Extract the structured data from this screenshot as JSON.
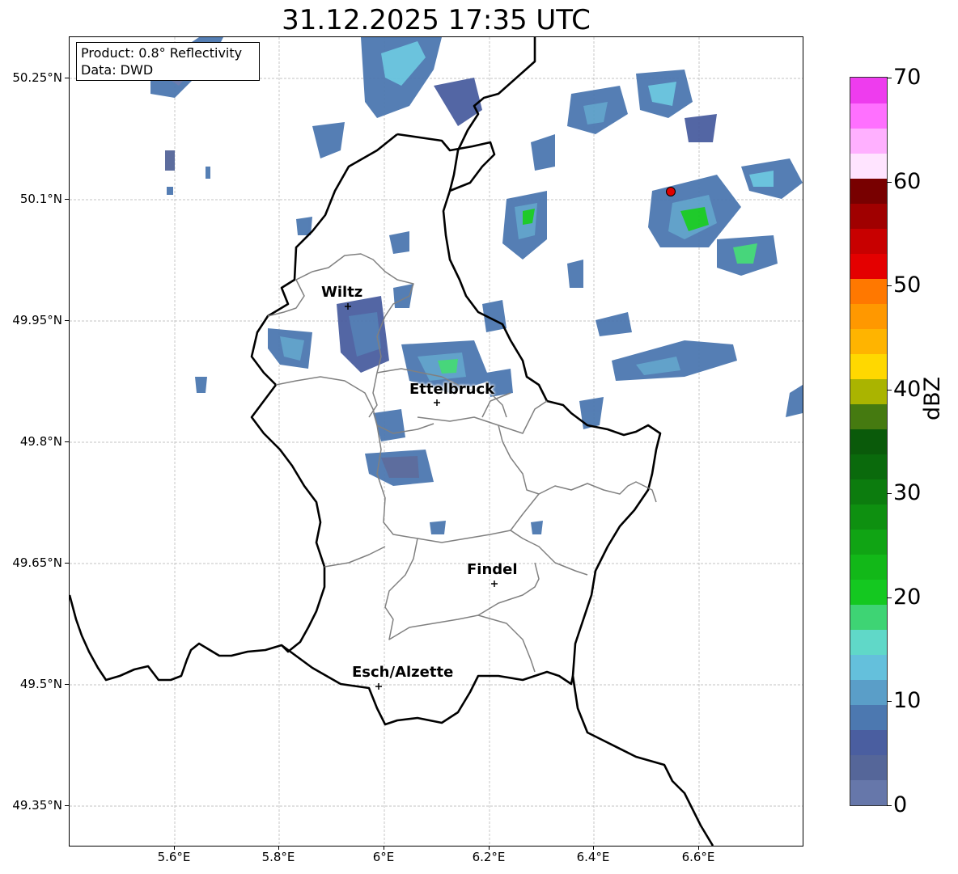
{
  "title": "31.12.2025 17:35 UTC",
  "info": {
    "product": "Product: 0.8° Reflectivity",
    "data": "Data: DWD"
  },
  "axes": {
    "lat_ticks": [
      "50.25°N",
      "50.1°N",
      "49.95°N",
      "49.8°N",
      "49.65°N",
      "49.5°N",
      "49.35°N"
    ],
    "lon_ticks": [
      "5.6°E",
      "5.8°E",
      "6°E",
      "6.2°E",
      "6.4°E",
      "6.6°E"
    ]
  },
  "cities": [
    {
      "name": "Wiltz",
      "lat": 49.966,
      "lon": 5.932
    },
    {
      "name": "Ettelbruck",
      "lat": 49.848,
      "lon": 6.104
    },
    {
      "name": "Findel",
      "lat": 49.627,
      "lon": 6.211
    },
    {
      "name": "Esch/Alzette",
      "lat": 49.499,
      "lon": 5.986
    }
  ],
  "radar_site_marker": {
    "lat": 50.11,
    "lon": 6.548,
    "color": "#e00000"
  },
  "colorbar": {
    "label": "dBZ",
    "ticks": [
      "0",
      "10",
      "20",
      "30",
      "40",
      "50",
      "60",
      "70"
    ],
    "min": 0,
    "max": 70,
    "step": 2.5,
    "colors": [
      "#6677aa",
      "#556699",
      "#4a5ea0",
      "#4c78b0",
      "#5a9ec8",
      "#64c0dc",
      "#60d8c8",
      "#3ed474",
      "#14c820",
      "#12b818",
      "#10a414",
      "#0e9010",
      "#0c7c0e",
      "#0a6a0c",
      "#0a5a0a",
      "#457a10",
      "#aab400",
      "#ffd800",
      "#ffb400",
      "#ff9800",
      "#ff7800",
      "#e40000",
      "#c80000",
      "#a00000",
      "#780000",
      "#ffe4ff",
      "#ffb0ff",
      "#ff70ff",
      "#ee3cee"
    ]
  }
}
